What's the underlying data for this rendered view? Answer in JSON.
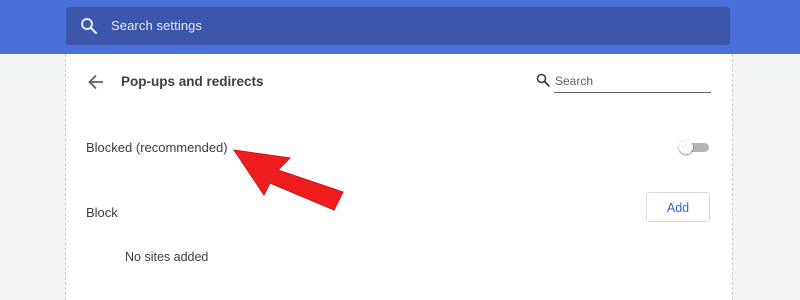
{
  "header": {
    "search_placeholder": "Search settings",
    "accent_color": "#4a6fd8",
    "searchbox_color": "#3b56aa"
  },
  "page": {
    "title": "Pop-ups and redirects",
    "search_placeholder": "Search",
    "back_icon": "arrow-back-icon"
  },
  "settings": {
    "blocked_label": "Blocked (recommended)",
    "blocked_toggle_on": false,
    "block_section_label": "Block",
    "add_button_label": "Add",
    "empty_list_text": "No sites added"
  },
  "annotation": {
    "arrow_color": "#ee1c1c",
    "points_to": "Blocked (recommended)"
  }
}
